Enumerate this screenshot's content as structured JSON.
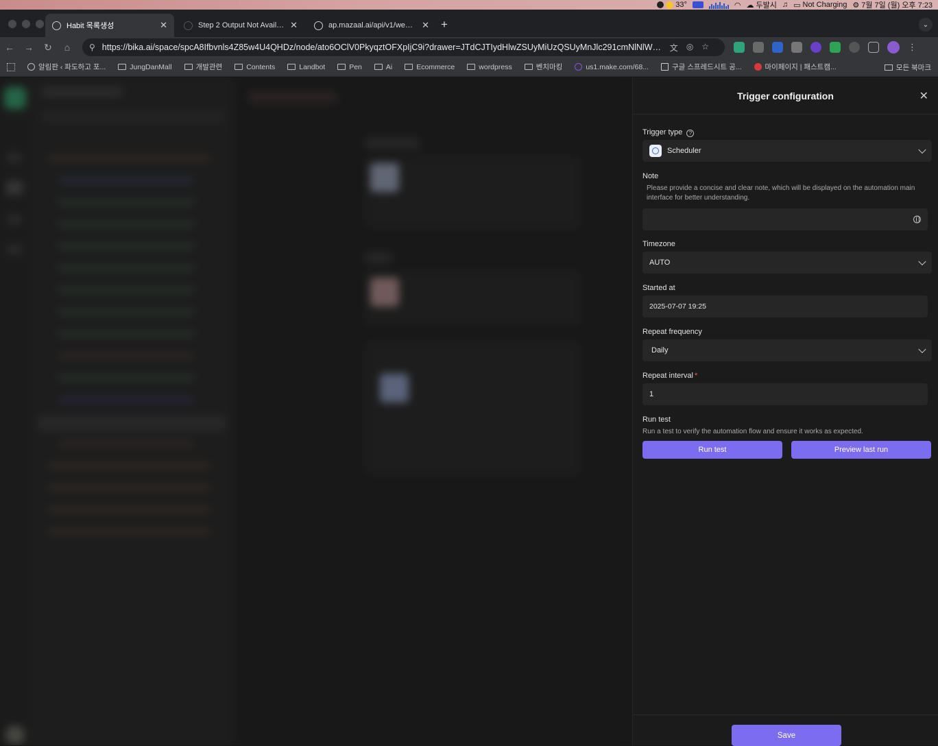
{
  "menubar": {
    "temperature": "33°",
    "weather_location": "두발시",
    "battery_status": "Not Charging",
    "datetime": "7월 7일 (월) 오후 7:23"
  },
  "browser": {
    "tabs": [
      {
        "title": "Habit 목록생성",
        "active": true
      },
      {
        "title": "Step 2 Output Not Available an",
        "active": false
      },
      {
        "title": "ap.mazaal.ai/api/v1/webhooks",
        "active": false
      }
    ],
    "url": "https://bika.ai/space/spcA8Ifbvnls4Z85w4U4QHDz/node/ato6OClV0PkyqztOFXpIjC9i?drawer=JTdCJTIydHlwZSUyMiUzQSUyMnJlc291cmNlNlWVkaXRvciU...",
    "bookmarks": [
      "알림판 ‹ 파도하고 포...",
      "JungDanMall",
      "개발관련",
      "Contents",
      "Landbot",
      "Pen",
      "Ai",
      "Ecommerce",
      "wordpress",
      "벤치마킹",
      "us1.make.com/68...",
      "구글 스프레드시트 공...",
      "마이페이지 | 패스트캠..."
    ],
    "bookmarks_right": "모든 북마크"
  },
  "drawer": {
    "title": "Trigger configuration",
    "trigger_type": {
      "label": "Trigger type",
      "value": "Scheduler"
    },
    "note": {
      "label": "Note",
      "description": "Please provide a concise and clear note, which will be displayed on the automation main interface for better understanding.",
      "value": ""
    },
    "timezone": {
      "label": "Timezone",
      "value": "AUTO"
    },
    "started_at": {
      "label": "Started at",
      "value": "2025-07-07 19:25"
    },
    "repeat_frequency": {
      "label": "Repeat frequency",
      "value": "Daily"
    },
    "repeat_interval": {
      "label": "Repeat interval",
      "required_mark": "*",
      "value": "1"
    },
    "run_test": {
      "label": "Run test",
      "description": "Run a test to verify the automation flow and ensure it works as expected.",
      "run_button": "Run test",
      "preview_button": "Preview last run"
    },
    "save_button": "Save"
  },
  "colors": {
    "accent": "#7b6cf0",
    "panel_bg": "#1b1b1b",
    "field_bg": "#262626"
  }
}
